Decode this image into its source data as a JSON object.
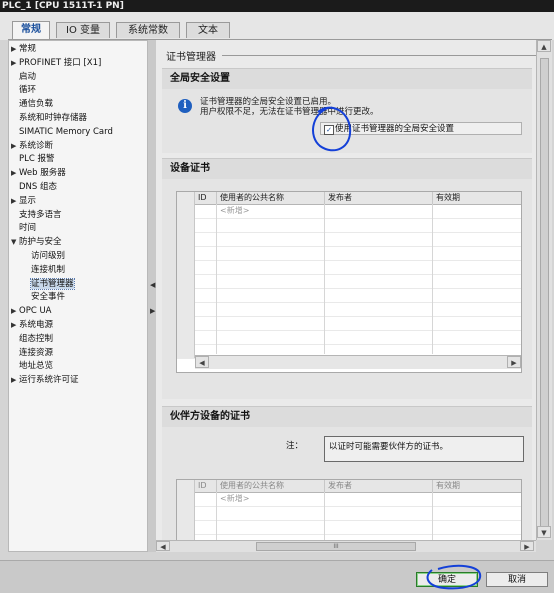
{
  "window": {
    "title": "PLC_1 [CPU 1511T-1 PN]"
  },
  "tabs": [
    {
      "label": "常规",
      "active": true
    },
    {
      "label": "IO 变量",
      "active": false
    },
    {
      "label": "系统常数",
      "active": false
    },
    {
      "label": "文本",
      "active": false
    }
  ],
  "tree": [
    {
      "label": "常规",
      "expandable": true,
      "expanded": false,
      "indent": 0
    },
    {
      "label": "PROFINET 接口 [X1]",
      "expandable": true,
      "expanded": false,
      "indent": 0
    },
    {
      "label": "启动",
      "expandable": false,
      "indent": 0
    },
    {
      "label": "循环",
      "expandable": false,
      "indent": 0
    },
    {
      "label": "通信负载",
      "expandable": false,
      "indent": 0
    },
    {
      "label": "系统和时钟存储器",
      "expandable": false,
      "indent": 0
    },
    {
      "label": "SIMATIC Memory Card",
      "expandable": false,
      "indent": 0
    },
    {
      "label": "系统诊断",
      "expandable": true,
      "expanded": false,
      "indent": 0
    },
    {
      "label": "PLC 报警",
      "expandable": false,
      "indent": 0
    },
    {
      "label": "Web 服务器",
      "expandable": true,
      "expanded": false,
      "indent": 0
    },
    {
      "label": "DNS 组态",
      "expandable": false,
      "indent": 0
    },
    {
      "label": "显示",
      "expandable": true,
      "expanded": false,
      "indent": 0
    },
    {
      "label": "支持多语言",
      "expandable": false,
      "indent": 0
    },
    {
      "label": "时间",
      "expandable": false,
      "indent": 0
    },
    {
      "label": "防护与安全",
      "expandable": true,
      "expanded": true,
      "indent": 0
    },
    {
      "label": "访问级别",
      "expandable": false,
      "indent": 1
    },
    {
      "label": "连接机制",
      "expandable": false,
      "indent": 1
    },
    {
      "label": "证书管理器",
      "expandable": false,
      "indent": 1,
      "selected": true
    },
    {
      "label": "安全事件",
      "expandable": false,
      "indent": 1
    },
    {
      "label": "OPC UA",
      "expandable": true,
      "expanded": false,
      "indent": 0
    },
    {
      "label": "系统电源",
      "expandable": true,
      "expanded": false,
      "indent": 0
    },
    {
      "label": "组态控制",
      "expandable": false,
      "indent": 0
    },
    {
      "label": "连接资源",
      "expandable": false,
      "indent": 0
    },
    {
      "label": "地址总览",
      "expandable": false,
      "indent": 0
    },
    {
      "label": "运行系统许可证",
      "expandable": true,
      "expanded": false,
      "indent": 0
    }
  ],
  "page": {
    "title": "证书管理器"
  },
  "global": {
    "heading": "全局安全设置",
    "info_line1": "证书管理器的全局安全设置已启用。",
    "info_line2": "用户权限不足，无法在证书管理器中进行更改。",
    "checkbox_label": "使用证书管理器的全局安全设置",
    "checkbox_checked": true
  },
  "device_certs": {
    "heading": "设备证书",
    "columns": [
      "ID",
      "使用者的公共名称",
      "发布者",
      "有效期"
    ],
    "new_row": "<新增>"
  },
  "partner_certs": {
    "heading": "伙伴方设备的证书",
    "note_label": "注：",
    "note_text": "以证时可能需要伙伴方的证书。",
    "columns": [
      "ID",
      "使用者的公共名称",
      "发布者",
      "有效期"
    ],
    "new_row": "<新增>"
  },
  "hscroll_grip": "III",
  "buttons": {
    "ok": "确定",
    "cancel": "取消"
  },
  "colors": {
    "accent": "#1a4f9c",
    "annotation": "#1440d8",
    "info": "#1f5fbf"
  }
}
